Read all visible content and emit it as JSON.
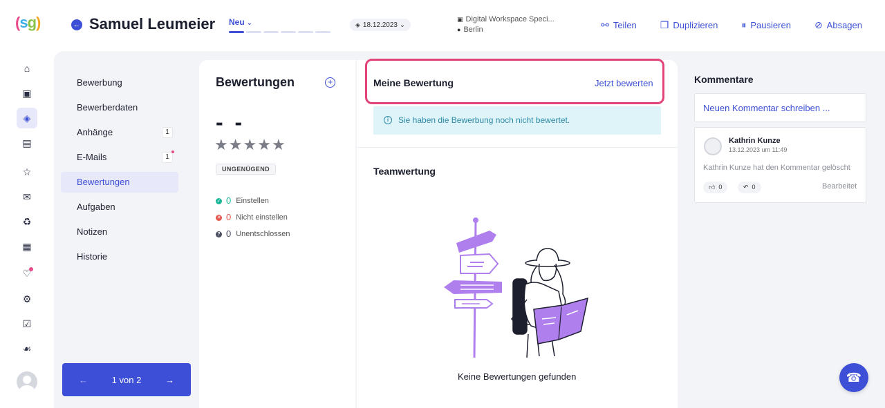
{
  "header": {
    "candidate_name": "Samuel Leumeier",
    "status_label": "Neu",
    "date": "18.12.2023",
    "job_title": "Digital Workspace Speci...",
    "location": "Berlin",
    "actions": {
      "share": "Teilen",
      "duplicate": "Duplizieren",
      "pause": "Pausieren",
      "cancel": "Absagen"
    }
  },
  "section_nav": {
    "items": [
      {
        "label": "Bewerbung"
      },
      {
        "label": "Bewerberdaten"
      },
      {
        "label": "Anhänge",
        "badge": "1"
      },
      {
        "label": "E-Mails",
        "badge": "1"
      },
      {
        "label": "Bewertungen"
      },
      {
        "label": "Aufgaben"
      },
      {
        "label": "Notizen"
      },
      {
        "label": "Historie"
      }
    ],
    "pager": "1 von 2"
  },
  "ratings": {
    "title": "Bewertungen",
    "score": "- -",
    "stars_total": 5,
    "stars_filled": 0,
    "grade": "UNGENÜGEND",
    "tally": {
      "hire": {
        "count": "0",
        "label": "Einstellen"
      },
      "no_hire": {
        "count": "0",
        "label": "Nicht einstellen"
      },
      "undecided": {
        "count": "0",
        "label": "Unentschlossen"
      }
    }
  },
  "my_rating": {
    "title": "Meine Bewertung",
    "action": "Jetzt bewerten",
    "info": "Sie haben die Bewerbung noch nicht bewertet."
  },
  "team_rating": {
    "title": "Teamwertung",
    "empty": "Keine Bewertungen gefunden"
  },
  "comments": {
    "title": "Kommentare",
    "placeholder": "Neuen Kommentar schreiben ...",
    "items": [
      {
        "author": "Kathrin Kunze",
        "date": "13.12.2023 um 11:49",
        "text": "Kathrin Kunze hat den Kommentar gelöscht",
        "likes": "0",
        "replies": "0",
        "edited": "Bearbeitet"
      }
    ]
  },
  "colors": {
    "accent": "#3d4fd6",
    "highlight": "#e2447a",
    "info_bg": "#dff4f8",
    "success": "#1fb79a",
    "danger": "#e4574e"
  }
}
